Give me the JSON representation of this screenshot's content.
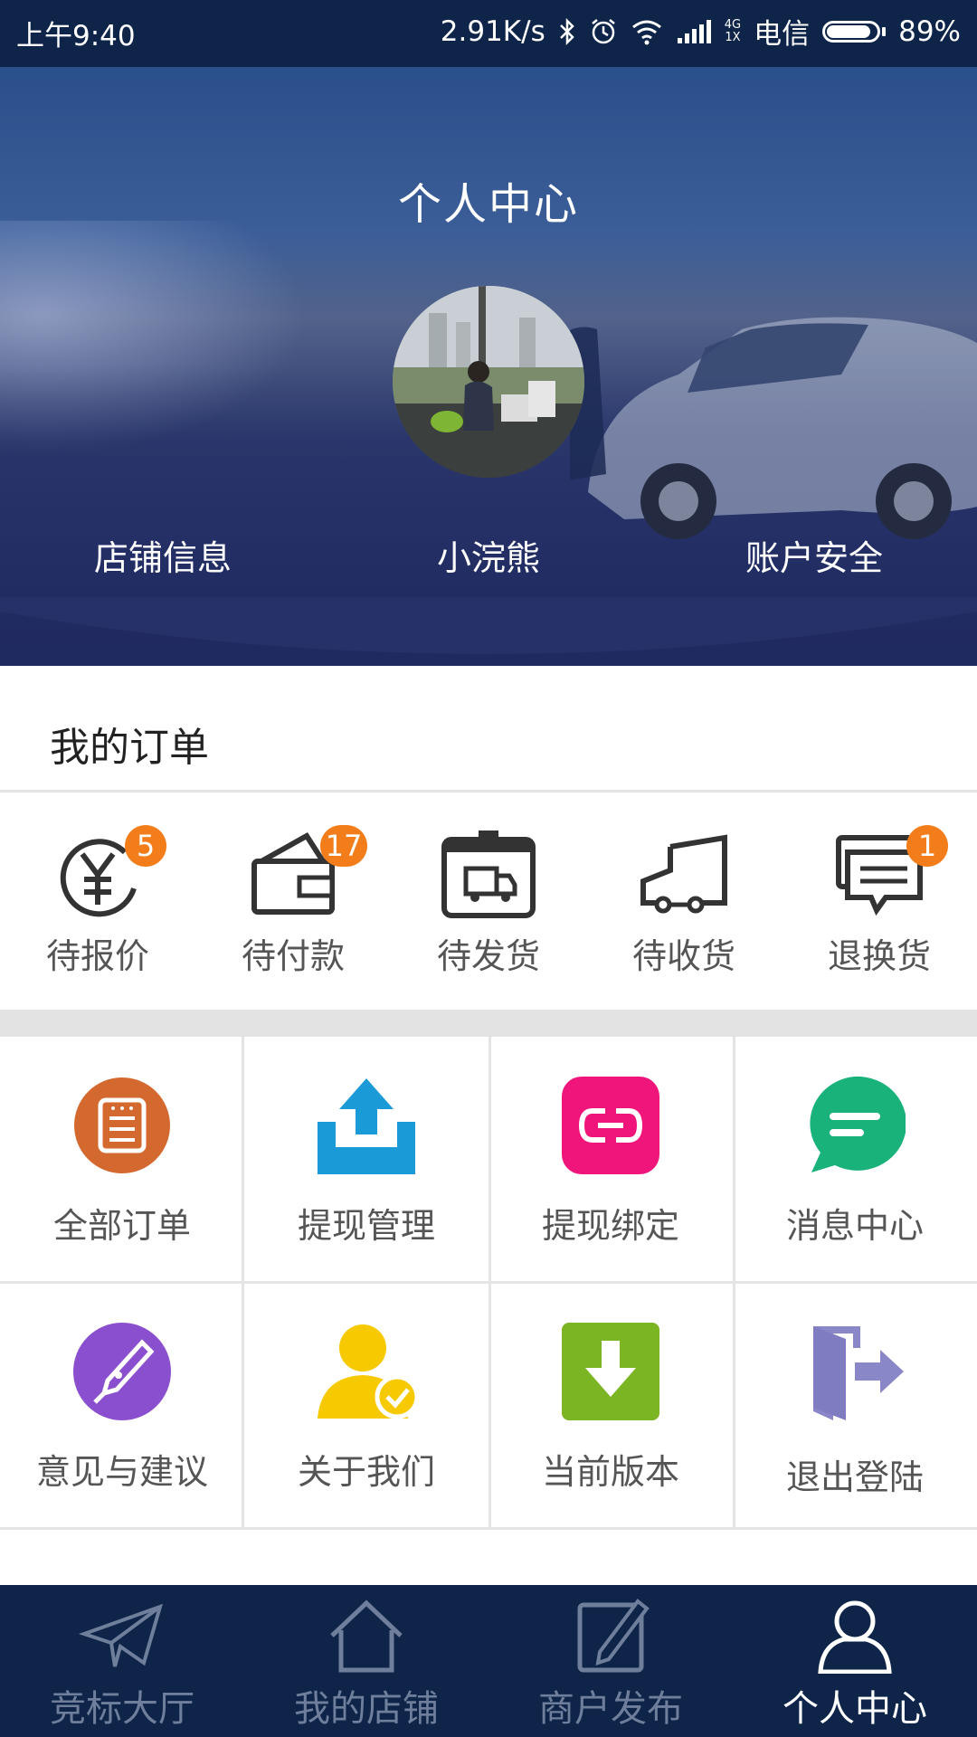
{
  "status_bar": {
    "time": "上午9:40",
    "network_speed": "2.91K/s",
    "network_type_top": "4G",
    "network_type_bottom": "1X",
    "carrier": "电信",
    "battery": "89%",
    "battery_level": 0.89
  },
  "header": {
    "title": "个人中心",
    "username": "小浣熊",
    "left_link": "店铺信息",
    "right_link": "账户安全"
  },
  "orders": {
    "title": "我的订单",
    "items": [
      {
        "label": "待报价",
        "badge": "5",
        "icon": "yen-quote-icon"
      },
      {
        "label": "待付款",
        "badge": "17",
        "icon": "wallet-icon"
      },
      {
        "label": "待发货",
        "badge": "",
        "icon": "truck-box-icon"
      },
      {
        "label": "待收货",
        "badge": "",
        "icon": "delivery-truck-icon"
      },
      {
        "label": "退换货",
        "badge": "1",
        "icon": "return-message-icon"
      }
    ]
  },
  "grid": {
    "items": [
      {
        "label": "全部订单",
        "icon": "order-list-icon",
        "color": "#d4692f"
      },
      {
        "label": "提现管理",
        "icon": "withdraw-upload-icon",
        "color": "#1a9ad6"
      },
      {
        "label": "提现绑定",
        "icon": "link-icon",
        "color": "#f0157a"
      },
      {
        "label": "消息中心",
        "icon": "chat-bubble-icon",
        "color": "#18b27a"
      },
      {
        "label": "意见与建议",
        "icon": "pen-icon",
        "color": "#8a4fcf"
      },
      {
        "label": "关于我们",
        "icon": "user-check-icon",
        "color": "#f7c900"
      },
      {
        "label": "当前版本",
        "icon": "download-icon",
        "color": "#7cb524"
      },
      {
        "label": "退出登陆",
        "icon": "exit-door-icon",
        "color": "#8a87c8"
      }
    ]
  },
  "bottom_nav": {
    "items": [
      {
        "label": "竞标大厅",
        "icon": "paper-plane-icon",
        "active": false
      },
      {
        "label": "我的店铺",
        "icon": "home-icon",
        "active": false
      },
      {
        "label": "商户发布",
        "icon": "edit-icon",
        "active": false
      },
      {
        "label": "个人中心",
        "icon": "person-icon",
        "active": true
      }
    ],
    "active_color": "#ffffff",
    "inactive_color": "#6f7f9b"
  }
}
